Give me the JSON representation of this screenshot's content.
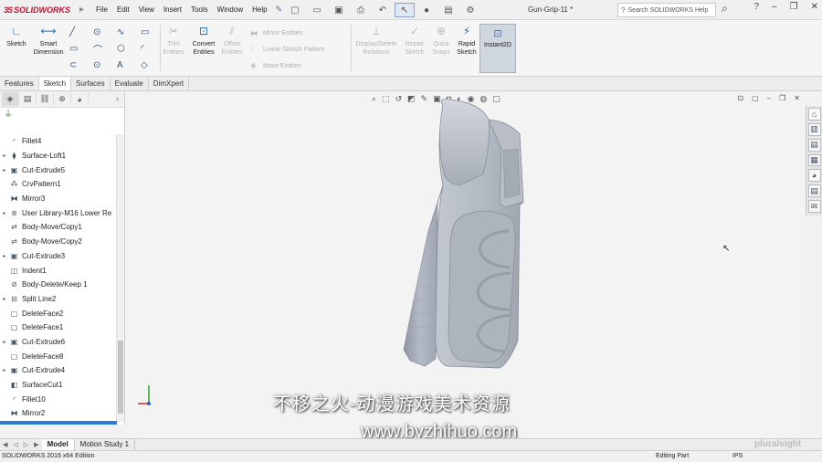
{
  "app": {
    "logo": "SOLIDWORKS",
    "menus": [
      "File",
      "Edit",
      "View",
      "Insert",
      "Tools",
      "Window",
      "Help"
    ],
    "doc_title": "Gun-Grip-11 *",
    "search_placeholder": "Search SOLIDWORKS Help"
  },
  "ribbon": {
    "sketch": "Sketch",
    "smart_dimension": "Smart Dimension",
    "trim_entities": "Trim Entities",
    "convert_entities": "Convert Entities",
    "offset_entities": "Offset Entities",
    "mirror_entities": "Mirror Entities",
    "linear_pattern": "Linear Sketch Pattern",
    "move_entities": "Move Entities",
    "display_relations": "Display/Delete Relations",
    "repair_sketch": "Repair Sketch",
    "quick_snaps": "Quick Snaps",
    "rapid_sketch": "Rapid Sketch",
    "instant2d": "Instant2D"
  },
  "cm_tabs": [
    "Features",
    "Sketch",
    "Surfaces",
    "Evaluate",
    "DimXpert"
  ],
  "cm_active": "Sketch",
  "tree": [
    {
      "label": "Fillet4",
      "icon": "fillet-icon",
      "expandable": false
    },
    {
      "label": "Surface-Loft1",
      "icon": "surface-loft-icon",
      "expandable": true
    },
    {
      "label": "Cut-Extrude5",
      "icon": "cut-extrude-icon",
      "expandable": true
    },
    {
      "label": "CrvPattern1",
      "icon": "curve-pattern-icon",
      "expandable": false
    },
    {
      "label": "Mirror3",
      "icon": "mirror-icon",
      "expandable": false
    },
    {
      "label": "User Library-M16 Lower Re",
      "icon": "library-feature-icon",
      "expandable": true
    },
    {
      "label": "Body-Move/Copy1",
      "icon": "body-move-icon",
      "expandable": false
    },
    {
      "label": "Body-Move/Copy2",
      "icon": "body-move-icon",
      "expandable": false
    },
    {
      "label": "Cut-Extrude3",
      "icon": "cut-extrude-icon",
      "expandable": true
    },
    {
      "label": "Indent1",
      "icon": "indent-icon",
      "expandable": false
    },
    {
      "label": "Body-Delete/Keep 1",
      "icon": "body-delete-icon",
      "expandable": false
    },
    {
      "label": "Split Line2",
      "icon": "split-line-icon",
      "expandable": true
    },
    {
      "label": "DeleteFace2",
      "icon": "delete-face-icon",
      "expandable": false
    },
    {
      "label": "DeleteFace1",
      "icon": "delete-face-icon",
      "expandable": false
    },
    {
      "label": "Cut-Extrude6",
      "icon": "cut-extrude-icon",
      "expandable": true
    },
    {
      "label": "DeleteFace8",
      "icon": "delete-face-icon",
      "expandable": false
    },
    {
      "label": "Cut-Extrude4",
      "icon": "cut-extrude-icon",
      "expandable": true
    },
    {
      "label": "SurfaceCut1",
      "icon": "surface-cut-icon",
      "expandable": false
    },
    {
      "label": "Fillet10",
      "icon": "fillet-icon",
      "expandable": false
    },
    {
      "label": "Mirror2",
      "icon": "mirror-icon",
      "expandable": false
    }
  ],
  "bottom_tabs": [
    "Model",
    "Motion Study 1"
  ],
  "bottom_active": "Model",
  "status": {
    "edition": "SOLIDWORKS 2016 x64 Edition",
    "mode": "Editing Part",
    "units": "IPS"
  },
  "watermark": {
    "line1": "不移之火-动漫游戏美术资源",
    "line2": "www.byzhihuo.com",
    "brand": "pluralsight"
  },
  "colors": {
    "brand_red": "#c8102e",
    "accent_blue": "#2b7bd6",
    "model_gray": "#aeb4bf"
  }
}
